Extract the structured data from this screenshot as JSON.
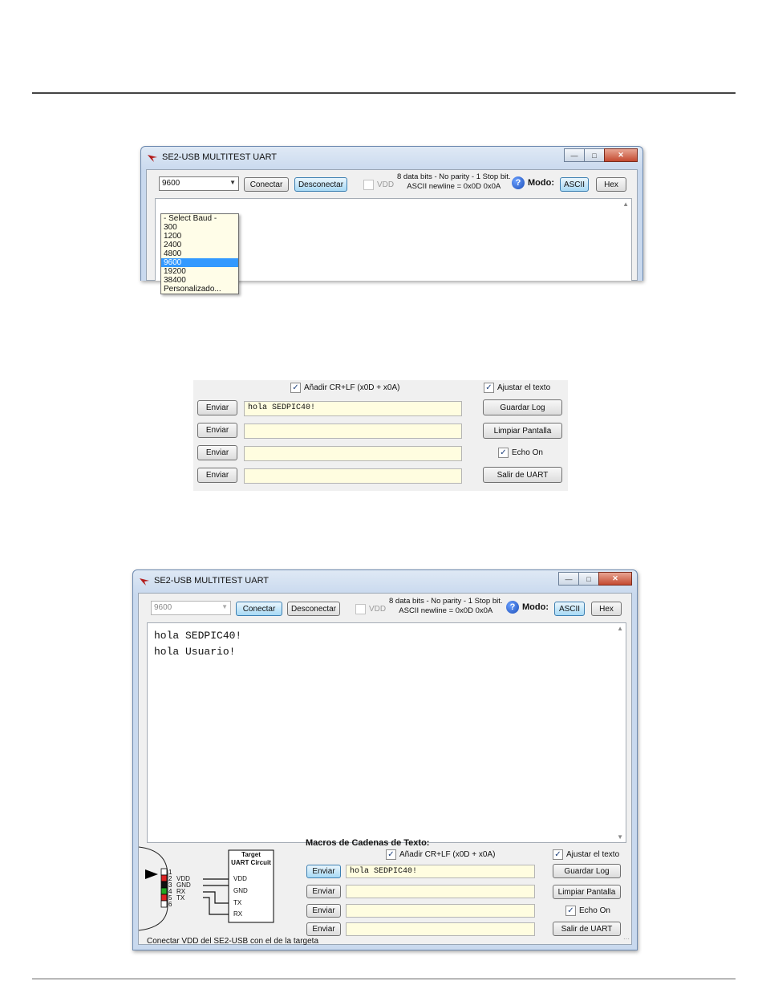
{
  "window1": {
    "title": "SE2-USB MULTITEST UART",
    "baud_value": "9600",
    "connect_label": "Conectar",
    "disconnect_label": "Desconectar",
    "vdd_label": "VDD",
    "info_line1": "8 data bits - No parity - 1 Stop bit.",
    "info_line2": "ASCII newline = 0x0D 0x0A",
    "modo_label": "Modo:",
    "ascii_label": "ASCII",
    "hex_label": "Hex",
    "baud_options": [
      "- Select Baud -",
      "300",
      "1200",
      "2400",
      "4800",
      "9600",
      "19200",
      "38400",
      "Personalizado..."
    ],
    "selected_index": 5
  },
  "panel": {
    "crlf_label": "Añadir CR+LF (x0D + x0A)",
    "wrap_label": "Ajustar el texto",
    "send_label": "Enviar",
    "macros": [
      "hola SEDPIC40!",
      "",
      "",
      ""
    ],
    "save_log_label": "Guardar Log",
    "clear_label": "Limpiar Pantalla",
    "echo_label": "Echo On",
    "exit_label": "Salir de UART"
  },
  "window2": {
    "title": "SE2-USB MULTITEST UART",
    "baud_value": "9600",
    "connect_label": "Conectar",
    "disconnect_label": "Desconectar",
    "vdd_label": "VDD",
    "info_line1": "8 data bits - No parity - 1 Stop bit.",
    "info_line2": "ASCII newline = 0x0D 0x0A",
    "modo_label": "Modo:",
    "ascii_label": "ASCII",
    "hex_label": "Hex",
    "output_lines": [
      "hola SEDPIC40!",
      "hola Usuario!"
    ],
    "macros_title": "Macros de Cadenas de Texto:",
    "crlf_label": "Añadir CR+LF (x0D + x0A)",
    "wrap_label": "Ajustar el texto",
    "send_label": "Enviar",
    "macros": [
      "hola SEDPIC40!",
      "",
      "",
      ""
    ],
    "save_log_label": "Guardar Log",
    "clear_label": "Limpiar Pantalla",
    "echo_label": "Echo On",
    "exit_label": "Salir de UART",
    "diagram": {
      "target_title_1": "Target",
      "target_title_2": "UART Circuit",
      "pins": [
        "1",
        "2",
        "3",
        "4",
        "5",
        "6"
      ],
      "conn_labels": [
        "VDD",
        "GND",
        "RX",
        "TX"
      ],
      "target_labels": [
        "VDD",
        "GND",
        "TX",
        "RX"
      ],
      "caption": "Conectar VDD del SE2-USB con el de la targeta"
    }
  },
  "colors": {
    "field_bg": "#fffde0",
    "selected": "#3399ff",
    "highlight_button": "#a7d9f5"
  }
}
